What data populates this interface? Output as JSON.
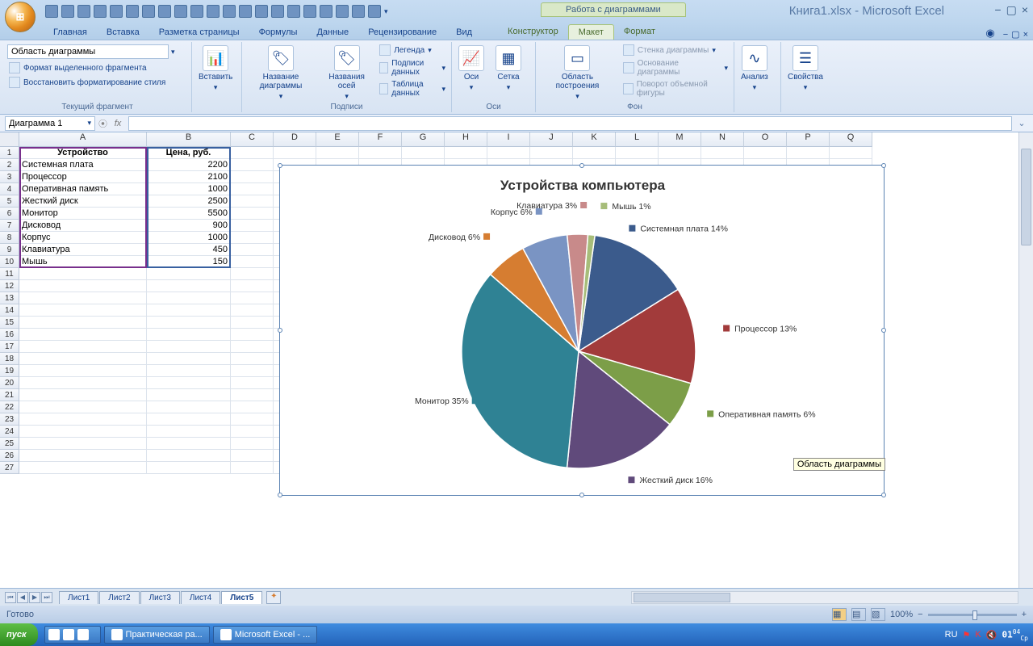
{
  "app": {
    "title": "Книга1.xlsx - Microsoft Excel",
    "context_title": "Работа с диаграммами"
  },
  "tabs": {
    "items": [
      "Главная",
      "Вставка",
      "Разметка страницы",
      "Формулы",
      "Данные",
      "Рецензирование",
      "Вид"
    ],
    "ctx": [
      "Конструктор",
      "Макет",
      "Формат"
    ],
    "active": "Макет"
  },
  "ribbon": {
    "group1": {
      "title": "Текущий фрагмент",
      "select": "Область диаграммы",
      "btn1": "Формат выделенного фрагмента",
      "btn2": "Восстановить форматирование стиля"
    },
    "insert": "Вставить",
    "group_labels": {
      "title": "Подписи",
      "b1": "Название\nдиаграммы",
      "b2": "Названия\nосей",
      "s1": "Легенда",
      "s2": "Подписи данных",
      "s3": "Таблица данных"
    },
    "group_axes": {
      "title": "Оси",
      "b1": "Оси",
      "b2": "Сетка"
    },
    "group_bg": {
      "title": "Фон",
      "b1": "Область\nпостроения",
      "s1": "Стенка диаграммы",
      "s2": "Основание диаграммы",
      "s3": "Поворот объемной фигуры"
    },
    "group_an": "Анализ",
    "group_pr": "Свойства"
  },
  "namebox": "Диаграмма 1",
  "sheet": {
    "cols": [
      "A",
      "B",
      "C",
      "D",
      "E",
      "F",
      "G",
      "H",
      "I",
      "J",
      "K",
      "L",
      "M",
      "N",
      "O",
      "P",
      "Q"
    ],
    "header_row": [
      "Устройство",
      "Цена, руб."
    ],
    "rows": [
      [
        "Системная плата",
        "2200"
      ],
      [
        "Процессор",
        "2100"
      ],
      [
        "Оперативная память",
        "1000"
      ],
      [
        "Жесткий диск",
        "2500"
      ],
      [
        "Монитор",
        "5500"
      ],
      [
        "Дисковод",
        "900"
      ],
      [
        "Корпус",
        "1000"
      ],
      [
        "Клавиатура",
        "450"
      ],
      [
        "Мышь",
        "150"
      ]
    ]
  },
  "tooltip": "Область диаграммы",
  "chart_data": {
    "type": "pie",
    "title": "Устройства компьютера",
    "categories": [
      "Системная плата",
      "Процессор",
      "Оперативная память",
      "Жесткий диск",
      "Монитор",
      "Дисковод",
      "Корпус",
      "Клавиатура",
      "Мышь"
    ],
    "values": [
      2200,
      2100,
      1000,
      2500,
      5500,
      900,
      1000,
      450,
      150
    ],
    "percents": [
      14,
      13,
      6,
      16,
      35,
      6,
      6,
      3,
      1
    ],
    "colors": [
      "#3b5b8c",
      "#a23b3b",
      "#7c9e48",
      "#604a7b",
      "#2f8294",
      "#d67d31",
      "#7a94c3",
      "#c88a8a",
      "#a7bd7a"
    ],
    "labels": [
      "Системная плата 14%",
      "Процессор 13%",
      "Оперативная память 6%",
      "Жесткий диск 16%",
      "Монитор 35%",
      "Дисковод 6%",
      "Корпус 6%",
      "Клавиатура 3%",
      "Мышь 1%"
    ]
  },
  "tabs_sheet": {
    "items": [
      "Лист1",
      "Лист2",
      "Лист3",
      "Лист4",
      "Лист5"
    ],
    "active": "Лист5"
  },
  "status": {
    "ready": "Готово",
    "zoom": "100%"
  },
  "taskbar": {
    "start": "пуск",
    "items": [
      "Практическая ра...",
      "Microsoft Excel - ..."
    ],
    "lang": "RU",
    "time": "01",
    "tmin": "04",
    "tday": "Ср"
  }
}
